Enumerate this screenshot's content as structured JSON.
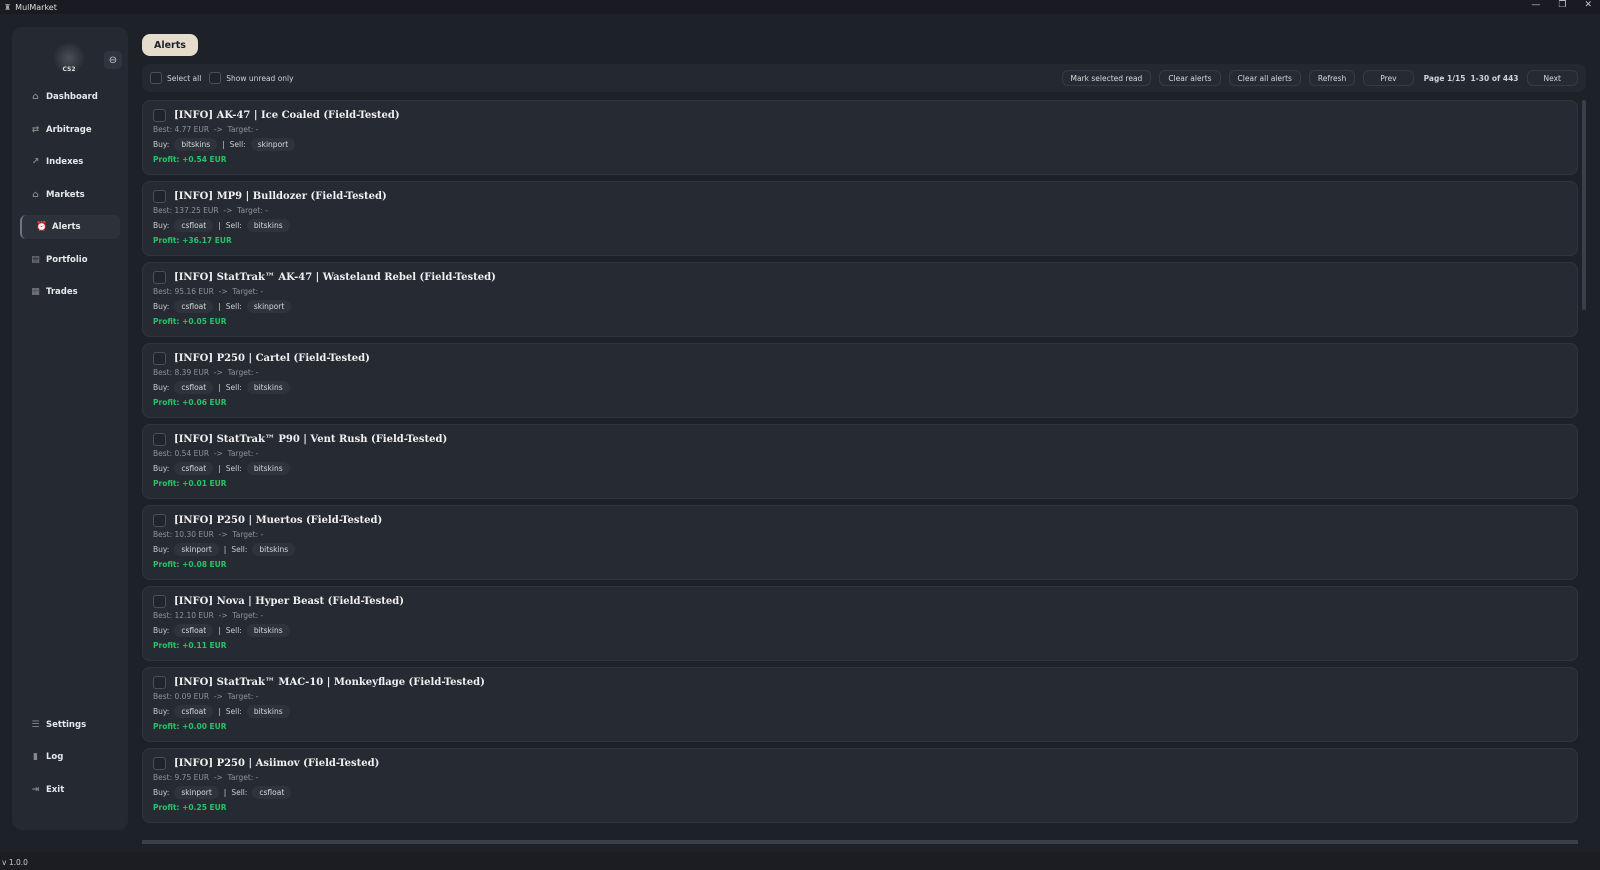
{
  "window": {
    "title": "MulMarket",
    "controls": [
      "minimize",
      "restore",
      "close"
    ]
  },
  "sidebar": {
    "logo_text": "CS2",
    "items": [
      {
        "label": "Dashboard",
        "icon": "home-icon"
      },
      {
        "label": "Arbitrage",
        "icon": "arrows-icon"
      },
      {
        "label": "Indexes",
        "icon": "trend-icon"
      },
      {
        "label": "Markets",
        "icon": "bank-icon"
      },
      {
        "label": "Alerts",
        "icon": "alarm-icon",
        "active": true
      },
      {
        "label": "Portfolio",
        "icon": "wallet-icon"
      },
      {
        "label": "Trades",
        "icon": "trades-icon"
      }
    ],
    "bottom": [
      {
        "label": "Settings",
        "icon": "sliders-icon"
      },
      {
        "label": "Log",
        "icon": "file-icon"
      },
      {
        "label": "Exit",
        "icon": "exit-icon"
      }
    ]
  },
  "tab": "Alerts",
  "toolbar": {
    "select_all": "Select all",
    "show_unread": "Show unread only",
    "mark_read": "Mark selected read",
    "clear": "Clear alerts",
    "clear_all": "Clear all alerts",
    "refresh": "Refresh",
    "prev": "Prev",
    "page": "Page 1/15",
    "range": "1-30 of 443",
    "next": "Next"
  },
  "labels": {
    "buy": "Buy:",
    "sell": "Sell:",
    "sep": "|",
    "arrow": "->",
    "target": "Target: -",
    "best_prefix": "Best:",
    "profit_prefix": "Profit:"
  },
  "alerts": [
    {
      "title": "[INFO] AK-47 | Ice Coaled (Field-Tested)",
      "best": "4.77 EUR",
      "buy": "bitskins",
      "sell": "skinport",
      "profit": "+0.54 EUR"
    },
    {
      "title": "[INFO] MP9 | Bulldozer (Field-Tested)",
      "best": "137.25 EUR",
      "buy": "csfloat",
      "sell": "bitskins",
      "profit": "+36.17 EUR"
    },
    {
      "title": "[INFO] StatTrak™ AK-47 | Wasteland Rebel (Field-Tested)",
      "best": "95.16 EUR",
      "buy": "csfloat",
      "sell": "skinport",
      "profit": "+0.05 EUR"
    },
    {
      "title": "[INFO] P250 | Cartel (Field-Tested)",
      "best": "8.39 EUR",
      "buy": "csfloat",
      "sell": "bitskins",
      "profit": "+0.06 EUR"
    },
    {
      "title": "[INFO] StatTrak™ P90 | Vent Rush (Field-Tested)",
      "best": "0.54 EUR",
      "buy": "csfloat",
      "sell": "bitskins",
      "profit": "+0.01 EUR"
    },
    {
      "title": "[INFO] P250 | Muertos (Field-Tested)",
      "best": "10.30 EUR",
      "buy": "skinport",
      "sell": "bitskins",
      "profit": "+0.08 EUR"
    },
    {
      "title": "[INFO] Nova | Hyper Beast (Field-Tested)",
      "best": "12.10 EUR",
      "buy": "csfloat",
      "sell": "bitskins",
      "profit": "+0.11 EUR"
    },
    {
      "title": "[INFO] StatTrak™ MAC-10 | Monkeyflage (Field-Tested)",
      "best": "0.09 EUR",
      "buy": "csfloat",
      "sell": "bitskins",
      "profit": "+0.00 EUR"
    },
    {
      "title": "[INFO] P250 | Asiimov (Field-Tested)",
      "best": "9.75 EUR",
      "buy": "skinport",
      "sell": "csfloat",
      "profit": "+0.25 EUR"
    }
  ],
  "version": "v 1.0.0"
}
